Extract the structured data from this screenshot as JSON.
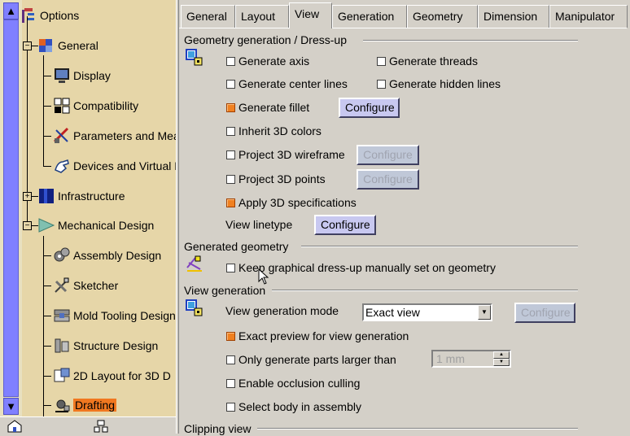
{
  "tree": {
    "scroll_up": "▲",
    "scroll_down": "▼",
    "items": [
      {
        "label": "Options",
        "icon": "options-tree-icon"
      },
      {
        "label": "General",
        "icon": "general-cube-icon"
      },
      {
        "label": "Display",
        "icon": "display-monitor-icon"
      },
      {
        "label": "Compatibility",
        "icon": "compatibility-icon"
      },
      {
        "label": "Parameters and Mea",
        "icon": "parameters-measure-icon"
      },
      {
        "label": "Devices and Virtual F",
        "icon": "devices-hand-icon"
      },
      {
        "label": "Infrastructure",
        "icon": "infrastructure-icon"
      },
      {
        "label": "Mechanical Design",
        "icon": "mechanical-design-icon"
      },
      {
        "label": "Assembly Design",
        "icon": "assembly-gears-icon"
      },
      {
        "label": "Sketcher",
        "icon": "sketcher-icon"
      },
      {
        "label": "Mold Tooling Design",
        "icon": "mold-tooling-icon"
      },
      {
        "label": "Structure Design",
        "icon": "structure-design-icon"
      },
      {
        "label": "2D Layout for 3D D",
        "icon": "layout-2d-icon"
      },
      {
        "label": "Drafting",
        "icon": "drafting-icon"
      }
    ]
  },
  "tabs": [
    "General",
    "Layout",
    "View",
    "Generation",
    "Geometry",
    "Dimension",
    "Manipulator"
  ],
  "active_tab": "View",
  "sections": {
    "dressup": {
      "title": "Geometry generation / Dress-up",
      "generate_axis": "Generate axis",
      "generate_threads": "Generate threads",
      "generate_center_lines": "Generate center lines",
      "generate_hidden_lines": "Generate hidden lines",
      "generate_fillet": "Generate fillet",
      "inherit_3d_colors": "Inherit 3D colors",
      "project_3d_wireframe": "Project 3D wireframe",
      "project_3d_points": "Project 3D points",
      "apply_3d_specifications": "Apply 3D specifications",
      "view_linetype": "View linetype",
      "configure": "Configure"
    },
    "generated_geometry": {
      "title": "Generated geometry",
      "keep_dressup": "Keep graphical dress-up manually set on geometry"
    },
    "view_generation": {
      "title": "View generation",
      "mode_label": "View generation mode",
      "mode_value": "Exact view",
      "configure": "Configure",
      "exact_preview": "Exact preview for view generation",
      "only_generate_parts": "Only generate parts larger than",
      "size_value": "1 mm",
      "enable_occlusion": "Enable occlusion culling",
      "select_body": "Select body in assembly"
    },
    "clipping": {
      "title": "Clipping view"
    }
  },
  "colors": {
    "tree_bg": "#e6d6a8",
    "selection": "#f07820",
    "button": "#c8c8f0",
    "scrollbar": "#8080ff"
  }
}
